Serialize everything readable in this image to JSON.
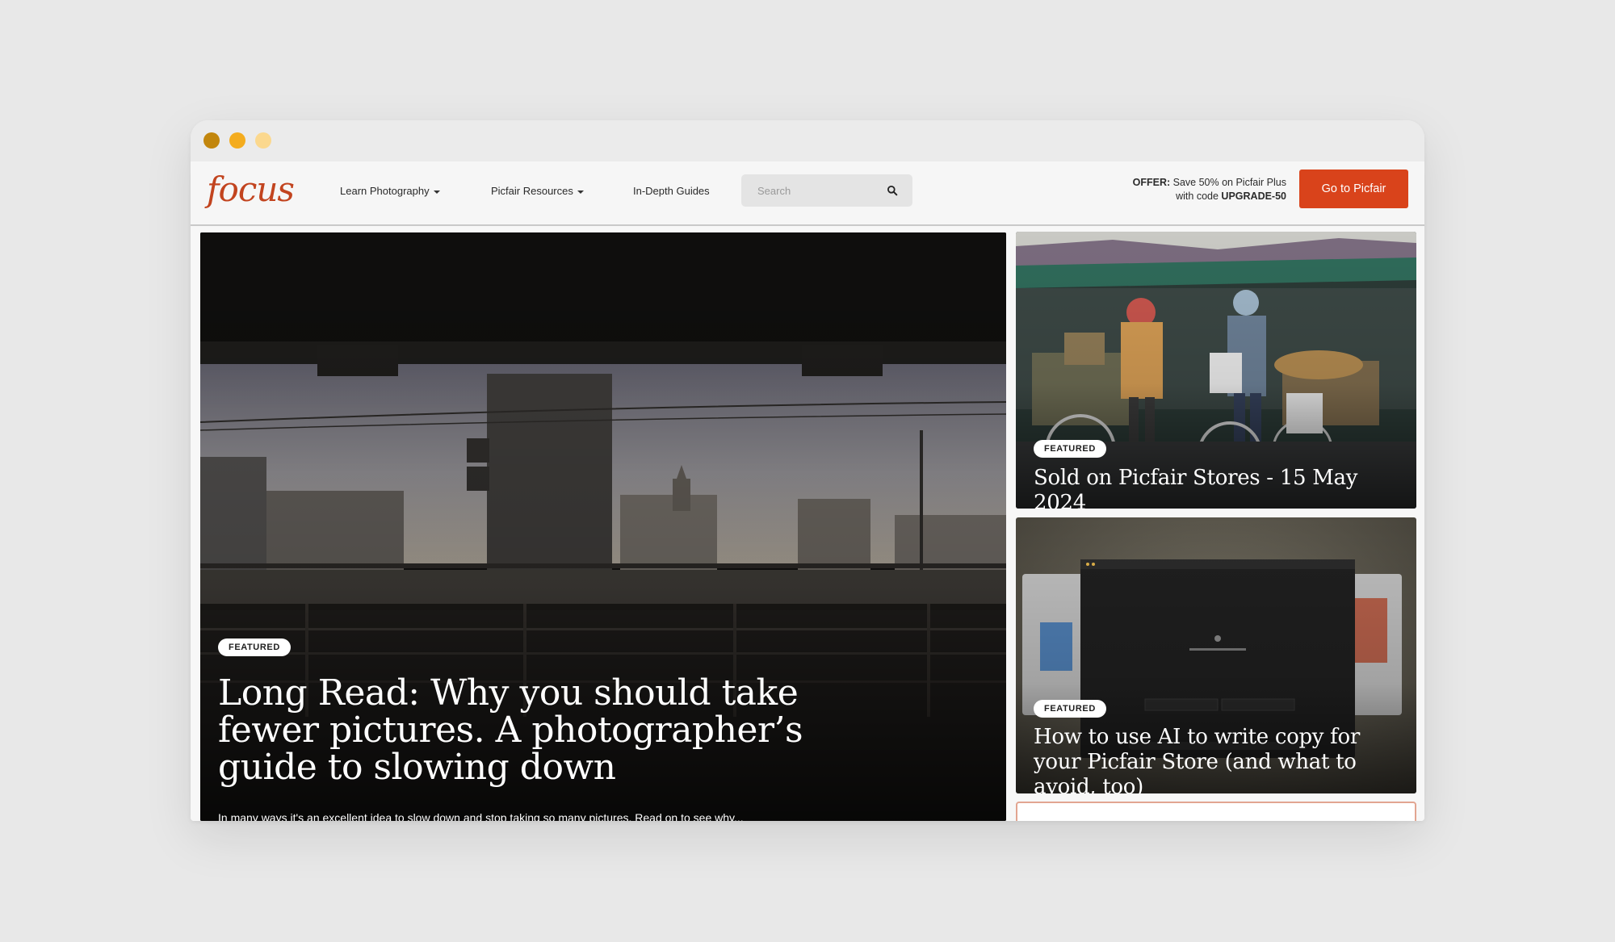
{
  "window": {
    "controls": [
      "close",
      "minimize",
      "zoom"
    ]
  },
  "nav": {
    "logo": "focus",
    "items": [
      {
        "label": "Learn Photography",
        "has_dropdown": true
      },
      {
        "label": "Picfair Resources",
        "has_dropdown": true
      },
      {
        "label": "In-Depth Guides",
        "has_dropdown": false
      }
    ],
    "search_placeholder": "Search",
    "search_icon": "search-icon",
    "offer_prefix": "OFFER:",
    "offer_text": "Save 50% on Picfair Plus",
    "offer_code_prefix": "with code",
    "offer_code": "UPGRADE-50",
    "cta_label": "Go to Picfair"
  },
  "hero": {
    "badge": "FEATURED",
    "title": "Long Read: Why you should take fewer pictures. A photographer’s guide to slowing down",
    "excerpt": "In many ways it's an excellent idea to slow down and stop taking so many pictures. Read on to see why..."
  },
  "cards": [
    {
      "badge": "FEATURED",
      "title": "Sold on Picfair Stores - 15 May 2024"
    },
    {
      "badge": "FEATURED",
      "title": "How to use AI to write copy for your Picfair Store (and what to avoid, too)"
    }
  ],
  "colors": {
    "accent": "#d9431b",
    "logo": "#c2441f",
    "page_bg": "#e8e8e8"
  }
}
